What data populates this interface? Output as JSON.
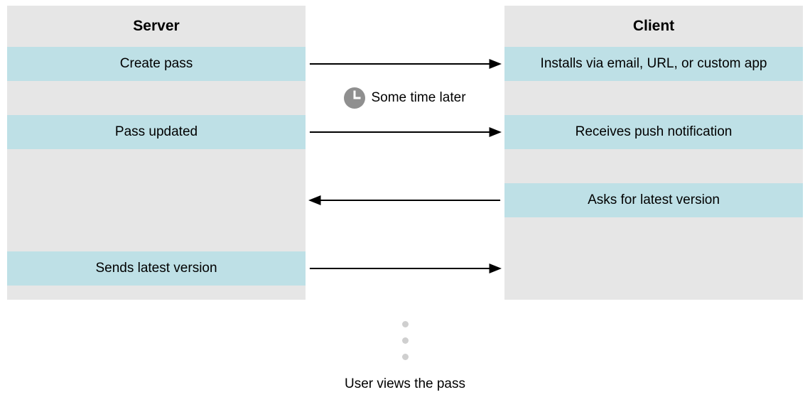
{
  "header": {
    "server": "Server",
    "client": "Client"
  },
  "rows": [
    {
      "server": "Create pass",
      "client": "Installs via email, URL, or custom app",
      "arrow": "right"
    },
    {
      "server": null,
      "client": null,
      "arrow": null,
      "note": "Some time later"
    },
    {
      "server": "Pass updated",
      "client": "Receives push notification",
      "arrow": "right"
    },
    {
      "server": null,
      "client": null,
      "arrow": null
    },
    {
      "server": null,
      "client": "Asks for latest version",
      "arrow": "left"
    },
    {
      "server": null,
      "client": null,
      "arrow": null
    },
    {
      "server": "Sends latest version",
      "client": null,
      "arrow": "right"
    }
  ],
  "caption": "User views the pass",
  "colors": {
    "lane_bg": "#e6e6e6",
    "step_bg": "#bee0e6",
    "clock_bg": "#8f8f8f",
    "dot": "#cfcfcf"
  },
  "chart_data": {
    "type": "table",
    "title": "Server–Client pass update sequence",
    "columns": [
      "Server",
      "Direction",
      "Client"
    ],
    "rows": [
      [
        "Create pass",
        "→",
        "Installs via email, URL, or custom app"
      ],
      [
        "",
        "(Some time later)",
        ""
      ],
      [
        "Pass updated",
        "→",
        "Receives push notification"
      ],
      [
        "",
        "←",
        "Asks for latest version"
      ],
      [
        "Sends latest version",
        "→",
        ""
      ]
    ],
    "caption": "User views the pass"
  }
}
